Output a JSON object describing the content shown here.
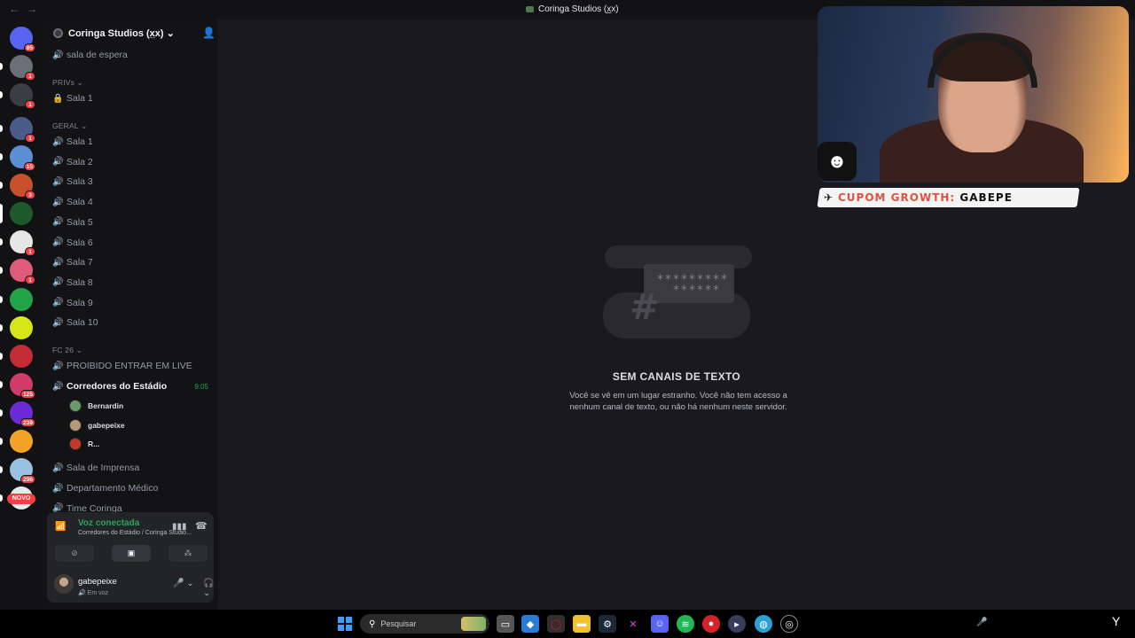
{
  "titlebar": {
    "title": "Coringa Studios (x̲x)"
  },
  "rail": {
    "servers": [
      {
        "name": "dm",
        "badge": "85",
        "color": "#5865f2"
      },
      {
        "name": "srv-1",
        "badge": "1",
        "color": "#6a6f78"
      },
      {
        "name": "srv-2",
        "badge": "1",
        "color": "#3b3d44"
      },
      {
        "name": "srv-3",
        "badge": "1",
        "color": "#4a5a8a"
      },
      {
        "name": "srv-4",
        "badge": "15",
        "color": "#5a8fd6"
      },
      {
        "name": "srv-5",
        "badge": "3",
        "color": "#c94f2a"
      },
      {
        "name": "srv-6",
        "badge": "",
        "color": "#1e5a2a",
        "active": true
      },
      {
        "name": "srv-7",
        "badge": "1",
        "color": "#e6e6e6"
      },
      {
        "name": "srv-8",
        "badge": "1",
        "color": "#e05a7a"
      },
      {
        "name": "srv-9",
        "badge": "",
        "color": "#22a447"
      },
      {
        "name": "srv-10",
        "badge": "",
        "color": "#d6e61a"
      },
      {
        "name": "srv-11",
        "badge": "",
        "color": "#c42b34"
      },
      {
        "name": "srv-12",
        "badge": "125",
        "color": "#d13b6a"
      },
      {
        "name": "srv-13",
        "badge": "239",
        "color": "#6a2bd6"
      },
      {
        "name": "srv-14",
        "badge": "",
        "color": "#f2a326"
      },
      {
        "name": "srv-15",
        "badge": "296",
        "color": "#9ac1e0"
      },
      {
        "name": "srv-16",
        "badge": "",
        "color": "#e8e8e8"
      }
    ],
    "novo_label": "NOVO"
  },
  "sidebar": {
    "server_name": "Coringa Studios (x̲x)",
    "top_channel": "sala de espera",
    "categories": {
      "privs": "PRIVs",
      "geral": "GERAL",
      "fc26": "FC 26"
    },
    "privs_channels": [
      "Sala 1"
    ],
    "geral_channels": [
      "Sala 1",
      "Sala 2",
      "Sala 3",
      "Sala 4",
      "Sala 5",
      "Sala 6",
      "Sala 7",
      "Sala 8",
      "Sala 9",
      "Sala 10"
    ],
    "fc26_channels": {
      "first": "PROIBIDO ENTRAR EM LIVE",
      "live": "Corredores do Estádio",
      "live_timer": "9:05",
      "members": [
        "Bernardin",
        "gabepeixe",
        "R..."
      ],
      "after": [
        "Sala de Imprensa",
        "Departamento Médico",
        "Time Coringa"
      ]
    }
  },
  "voice": {
    "status": "Voz conectada",
    "location": "Corredores do Estádio / Coringa Studio..."
  },
  "user": {
    "name": "gabepeixe",
    "status": "Em voz"
  },
  "main": {
    "empty_title": "SEM CANAIS DE TEXTO",
    "empty_desc": "Você se vê em um lugar estranho. Você não tem acesso a nenhum canal de texto, ou não há nenhum neste servidor."
  },
  "overlay": {
    "coupon_prefix": "CUPOM GROWTH:",
    "coupon_code": "GABEPE"
  },
  "taskbar": {
    "search_placeholder": "Pesquisar"
  }
}
